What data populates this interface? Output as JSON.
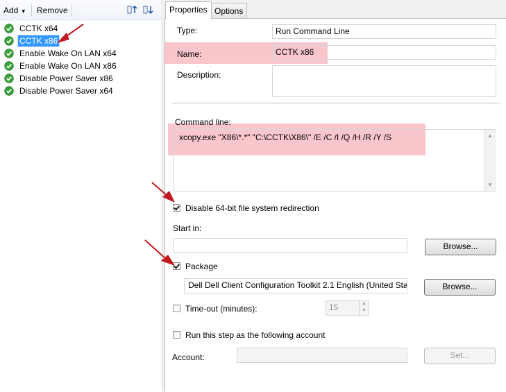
{
  "toolbar": {
    "add_label": "Add",
    "remove_label": "Remove"
  },
  "steps": [
    {
      "label": "CCTK x64",
      "selected": false
    },
    {
      "label": "CCTK x86",
      "selected": true
    },
    {
      "label": "Enable Wake On LAN x64",
      "selected": false
    },
    {
      "label": "Enable Wake On LAN x86",
      "selected": false
    },
    {
      "label": "Disable Power Saver x86",
      "selected": false
    },
    {
      "label": "Disable Power Saver x64",
      "selected": false
    }
  ],
  "tabs": [
    {
      "label": "Properties",
      "active": true
    },
    {
      "label": "Options",
      "active": false
    }
  ],
  "form": {
    "type_label": "Type:",
    "type_value": "Run Command Line",
    "name_label": "Name:",
    "name_value": "CCTK x86",
    "description_label": "Description:",
    "description_value": "",
    "command_line_label": "Command line:",
    "command_line_value": "xcopy.exe \"X86\\*.*\" \"C:\\CCTK\\X86\\\" /E /C /I /Q /H /R /Y /S",
    "disable_redirection_label": "Disable 64-bit file system redirection",
    "disable_redirection_checked": true,
    "start_in_label": "Start in:",
    "start_in_value": "",
    "browse_label": "Browse...",
    "package_label": "Package",
    "package_checked": true,
    "package_value": "Dell Dell Client Configuration Toolkit 2.1 English (United Sta",
    "timeout_label": "Time-out (minutes):",
    "timeout_checked": false,
    "timeout_value": "15",
    "run_as_label": "Run this step as the following account",
    "run_as_checked": false,
    "account_label": "Account:",
    "account_value": "",
    "set_label": "Set..."
  },
  "colors": {
    "highlight": "#f07882",
    "arrow": "#c0191f",
    "selection": "#3399ff",
    "check_green": "#3aa339"
  }
}
